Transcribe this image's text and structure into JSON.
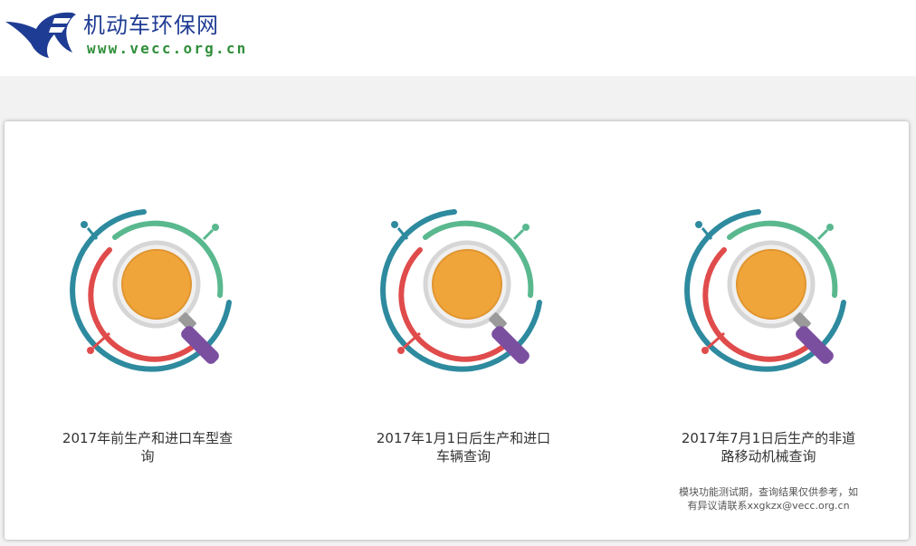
{
  "header": {
    "site_title": "机动车环保网",
    "site_url": "www.vecc.org.cn",
    "logo_icon": "flying-bird-logo-icon"
  },
  "colors": {
    "title_blue": "#1f3c94",
    "url_green": "#2f8f3a",
    "ring_teal": "#2e8a9e",
    "ring_green": "#5ab88f",
    "ring_red": "#e04b4b",
    "lens_orange": "#f0a53a",
    "handle_purple": "#7b4fa0",
    "page_band": "#f2f2f2"
  },
  "queries": [
    {
      "label": "2017年前生产和进口车型查询",
      "icon": "magnifier-search-icon"
    },
    {
      "label": "2017年1月1日后生产和进口车辆查询",
      "icon": "magnifier-search-icon"
    },
    {
      "label": "2017年7月1日后生产的非道路移动机械查询",
      "icon": "magnifier-search-icon",
      "note": "模块功能测试期，查询结果仅供参考，如有异议请联系xxgkzx@vecc.org.cn"
    }
  ]
}
